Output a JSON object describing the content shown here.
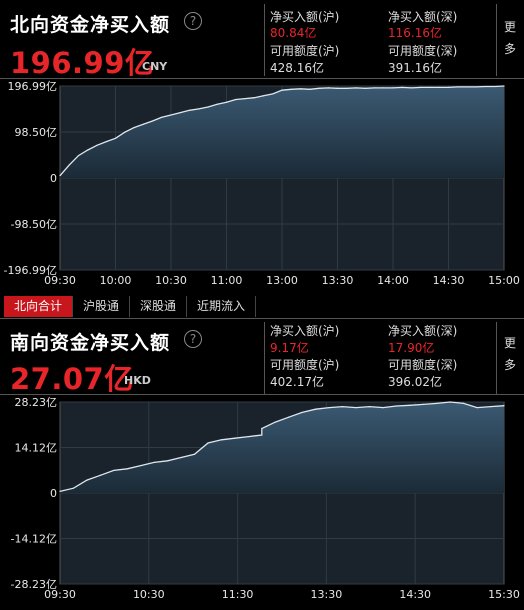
{
  "colors": {
    "accent_red": "#e8262a",
    "area_fill_top": "#3b5a73",
    "area_fill_bottom": "#1b2a36",
    "line": "#dfe6ee",
    "grid": "#2f3b44",
    "tab_active": "#c8161d"
  },
  "north": {
    "title": "北向资金净买入额",
    "help_icon": "?",
    "total": "196.99亿",
    "currency": "CNY",
    "stats": {
      "sh_label": "净买入额(沪)",
      "sh_value": "80.84亿",
      "sz_label": "净买入额(深)",
      "sz_value": "116.16亿",
      "sh_quota_label": "可用额度(沪)",
      "sh_quota_value": "428.16亿",
      "sz_quota_label": "可用额度(深)",
      "sz_quota_value": "391.16亿"
    },
    "more": [
      "更",
      "多"
    ]
  },
  "tabs": [
    "北向合计",
    "沪股通",
    "深股通",
    "近期流入"
  ],
  "south": {
    "title": "南向资金净买入额",
    "help_icon": "?",
    "total": "27.07亿",
    "currency": "HKD",
    "stats": {
      "sh_label": "净买入额(沪)",
      "sh_value": "9.17亿",
      "sz_label": "净买入额(深)",
      "sz_value": "17.90亿",
      "sh_quota_label": "可用额度(沪)",
      "sh_quota_value": "402.17亿",
      "sz_quota_label": "可用额度(深)",
      "sz_quota_value": "396.02亿"
    },
    "more": [
      "更",
      "多"
    ]
  },
  "chart_data": [
    {
      "type": "area",
      "title": "",
      "ylim": [
        -196.99,
        196.99
      ],
      "y_tick_labels": [
        "196.99亿",
        "98.50亿",
        "0",
        "-98.50亿",
        "-196.99亿"
      ],
      "y_ticks": [
        196.99,
        98.5,
        0,
        -98.5,
        -196.99
      ],
      "x_tick_labels": [
        "09:30",
        "10:00",
        "10:30",
        "11:00",
        "13:00",
        "13:30",
        "14:00",
        "14:30",
        "15:00"
      ],
      "x_session": "A-share",
      "x": [
        "09:30",
        "09:35",
        "09:40",
        "09:45",
        "09:50",
        "09:55",
        "10:00",
        "10:05",
        "10:10",
        "10:15",
        "10:20",
        "10:25",
        "10:30",
        "10:35",
        "10:40",
        "10:45",
        "10:50",
        "10:55",
        "11:00",
        "11:05",
        "11:10",
        "11:15",
        "11:20",
        "11:25",
        "11:30",
        "13:05",
        "13:10",
        "13:15",
        "13:20",
        "13:25",
        "13:30",
        "13:35",
        "13:40",
        "13:45",
        "13:50",
        "13:55",
        "14:00",
        "14:05",
        "14:10",
        "14:15",
        "14:20",
        "14:25",
        "14:30",
        "14:35",
        "14:40",
        "14:45",
        "14:50",
        "14:55",
        "15:00"
      ],
      "values": [
        5,
        28,
        48,
        60,
        70,
        78,
        85,
        98,
        108,
        115,
        122,
        130,
        135,
        140,
        145,
        148,
        152,
        158,
        162,
        168,
        170,
        172,
        176,
        180,
        188,
        190,
        191,
        190,
        192,
        193,
        192,
        192,
        193,
        192,
        193,
        193,
        193,
        194,
        193,
        194,
        194,
        194,
        194,
        195,
        195,
        195,
        196,
        196,
        196.99
      ]
    },
    {
      "type": "area",
      "title": "",
      "ylim": [
        -28.23,
        28.23
      ],
      "y_tick_labels": [
        "28.23亿",
        "14.12亿",
        "0",
        "-14.12亿",
        "-28.23亿"
      ],
      "y_ticks": [
        28.23,
        14.12,
        0,
        -14.12,
        -28.23
      ],
      "x_tick_labels": [
        "09:30",
        "10:30",
        "11:30",
        "13:30",
        "14:30",
        "15:30"
      ],
      "x_session": "HK",
      "x": [
        "09:30",
        "09:40",
        "09:50",
        "10:00",
        "10:10",
        "10:20",
        "10:30",
        "10:40",
        "10:50",
        "11:00",
        "11:10",
        "11:20",
        "11:30",
        "11:40",
        "11:50",
        "12:00",
        "13:00",
        "13:10",
        "13:20",
        "13:30",
        "13:40",
        "13:50",
        "14:00",
        "14:10",
        "14:20",
        "14:30",
        "14:40",
        "14:50",
        "15:00",
        "15:10",
        "15:20",
        "15:30",
        "15:40",
        "15:50",
        "16:00"
      ],
      "values": [
        0.5,
        1.5,
        4,
        5.5,
        7,
        7.5,
        8.5,
        9.5,
        10,
        11,
        12,
        15.5,
        16.5,
        17,
        17.5,
        18,
        20,
        22,
        23.5,
        25,
        26,
        26.5,
        26.8,
        26.5,
        26.8,
        26.5,
        27,
        27.2,
        27.5,
        27.8,
        28.23,
        27.8,
        26.5,
        26.8,
        27.07
      ]
    }
  ]
}
